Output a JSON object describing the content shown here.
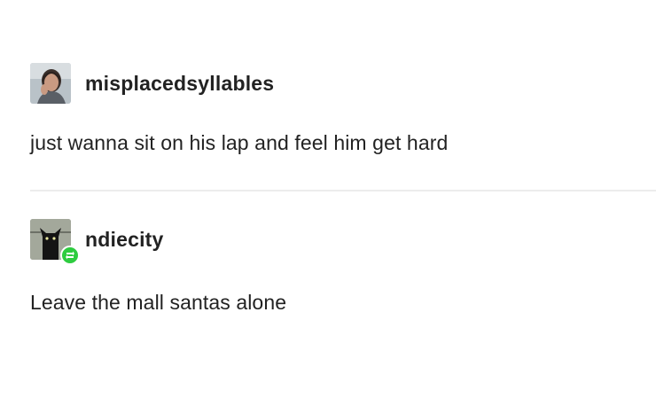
{
  "posts": [
    {
      "username": "misplacedsyllables",
      "text": "just wanna sit on his lap and feel him get hard",
      "avatar_icon": "user-avatar-photo"
    },
    {
      "username": "ndiecity",
      "text": "Leave the mall santas alone",
      "avatar_icon": "cat-avatar",
      "badge_icon": "reblog-icon"
    }
  ],
  "colors": {
    "background": "#ffffff",
    "text": "#222222",
    "divider": "#ececec",
    "reblog_badge": "#2ecc40"
  }
}
